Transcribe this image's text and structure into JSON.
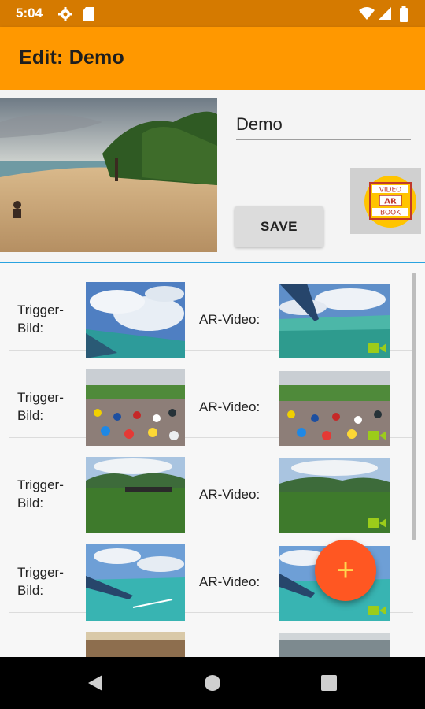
{
  "status_bar": {
    "time": "5:04"
  },
  "app_bar": {
    "title": "Edit: Demo"
  },
  "editor": {
    "name_value": "Demo",
    "save_label": "SAVE",
    "logo_text": [
      "VIDEO",
      "AR",
      "BOOK"
    ]
  },
  "list": {
    "rows": [
      {
        "trigger_label": "Trigger-\nBild:",
        "ar_label": "AR-Video:"
      },
      {
        "trigger_label": "Trigger-\nBild:",
        "ar_label": "AR-Video:"
      },
      {
        "trigger_label": "Trigger-\nBild:",
        "ar_label": "AR-Video:"
      },
      {
        "trigger_label": "Trigger-\nBild:",
        "ar_label": "AR-Video:"
      }
    ]
  },
  "fab": {
    "label": "+"
  },
  "colors": {
    "status_bar": "#d57a00",
    "app_bar": "#ff9800",
    "fab": "#ff5722",
    "accent_divider": "#29a3e0",
    "video_badge": "#9ccc1a"
  }
}
